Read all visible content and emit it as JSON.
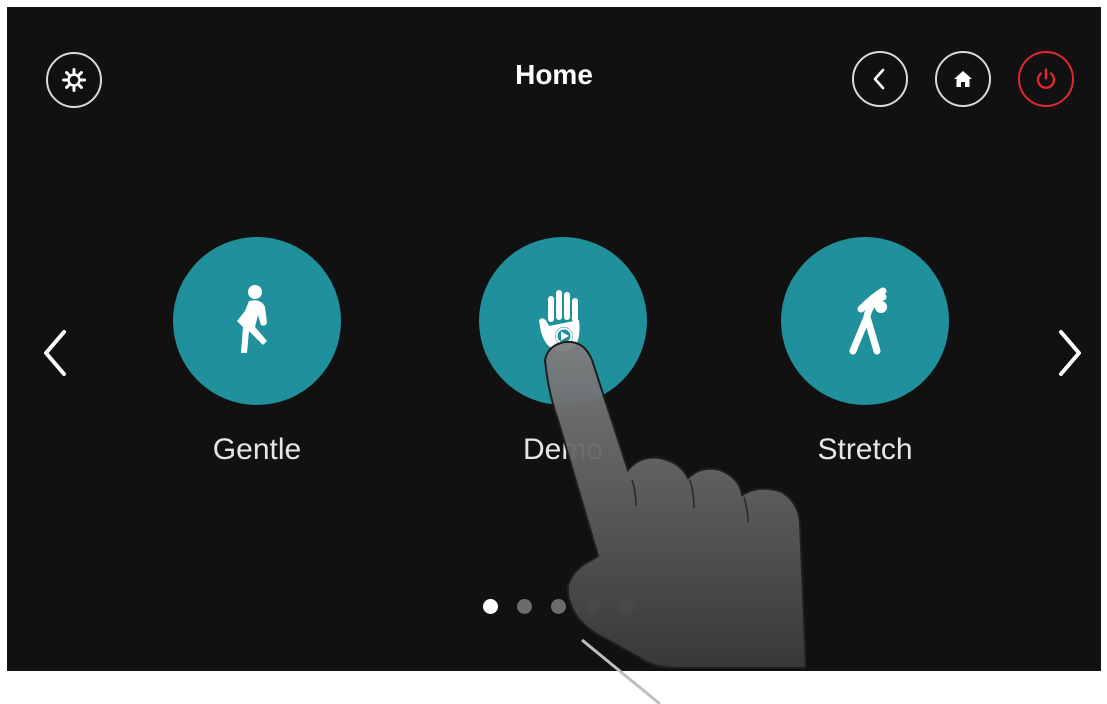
{
  "header": {
    "title": "Home",
    "settings_icon": "gear-icon",
    "back_icon": "chevron-left-icon",
    "home_icon": "home-icon",
    "power_icon": "power-icon",
    "power_color": "#e0282e"
  },
  "carousel": {
    "prev_icon": "chevron-left-icon",
    "next_icon": "chevron-right-icon",
    "accent": "#20919c",
    "items": [
      {
        "label": "Gentle",
        "icon": "walking-person-icon"
      },
      {
        "label": "Demo",
        "icon": "hand-play-icon"
      },
      {
        "label": "Stretch",
        "icon": "stretching-person-icon"
      }
    ],
    "pages": 5,
    "active_page": 1
  },
  "overlay": {
    "icon": "pointing-finger-icon"
  }
}
